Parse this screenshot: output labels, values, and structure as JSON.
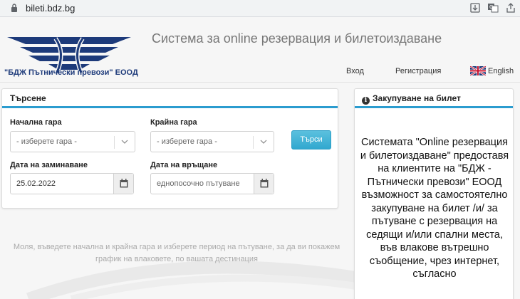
{
  "browser": {
    "url": "bileti.bdz.bg"
  },
  "header": {
    "company": "\"БДЖ Пътнически превози\" ЕООД",
    "system_title": "Система за online резервация и билетоиздаване",
    "nav": {
      "login": "Вход",
      "register": "Регистрация",
      "language": "English"
    }
  },
  "search": {
    "title": "Търсене",
    "from_label": "Начална гара",
    "from_placeholder": "- изберете гара -",
    "to_label": "Крайна гара",
    "to_placeholder": "- изберете гара -",
    "depart_label": "Дата на заминаване",
    "depart_value": "25.02.2022",
    "return_label": "Дата на връщане",
    "return_placeholder": "еднопосочно пътуване",
    "button": "Търси"
  },
  "hint": "Моля, въведете начална и крайна гара и изберете период на пътуване, за да ви покажем график на влаковете, по вашата дестинация",
  "info": {
    "title": "Закупуване на билет",
    "text": "Системата \"Online резервация и билетоиздаване\" предоставя на клиентите на \"БДЖ - Пътнически превози\" ЕООД възможност за самостоятелно закупуване на билет /и/ за пътуване с резервация на седящи и/или спални места, във влакове вътрешно съобщение, чрез интернет, съгласно"
  },
  "colors": {
    "accent": "#2b9ccf",
    "brand": "#1d3a7a",
    "button": "#31a8cf"
  }
}
